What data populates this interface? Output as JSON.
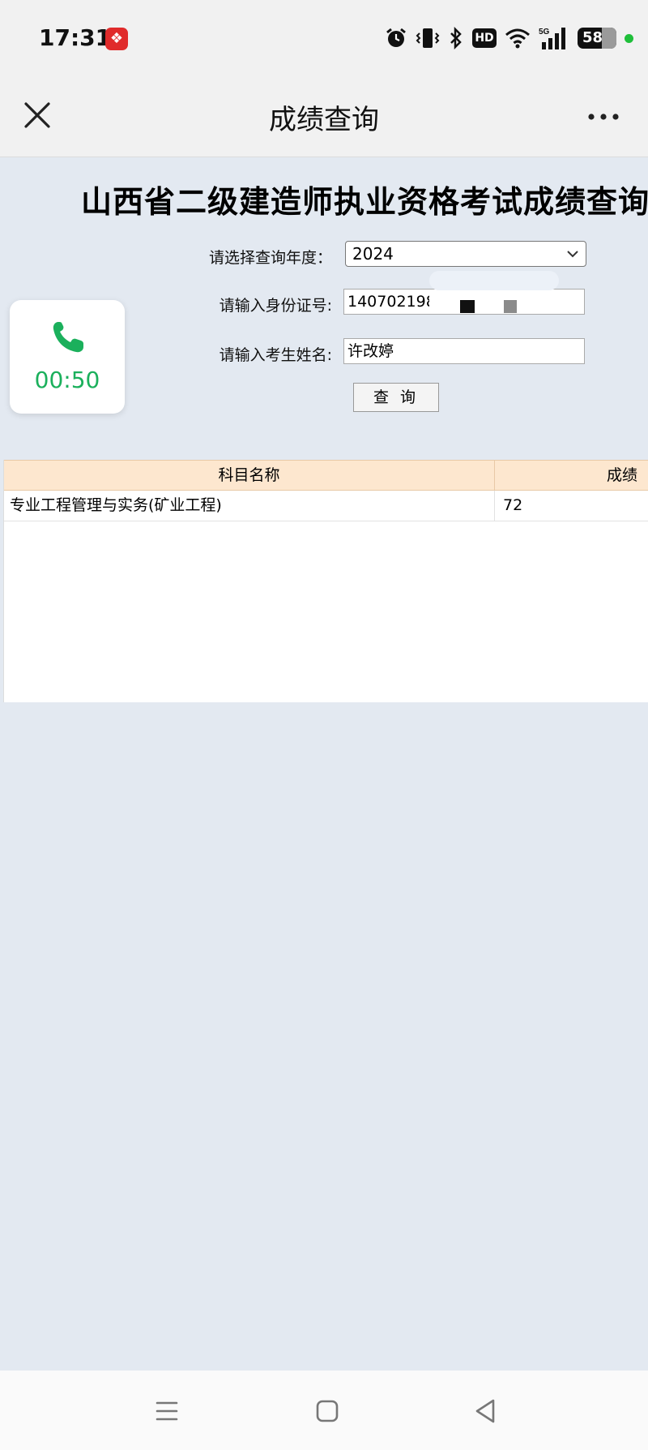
{
  "status_bar": {
    "time": "17:31",
    "app_badge_icon": "app-notification-icon",
    "icons": [
      "alarm-icon",
      "vibrate-icon",
      "bluetooth-icon",
      "hd-icon",
      "wifi-icon",
      "5g-signal-icon",
      "battery-icon"
    ],
    "hd_label": "HD",
    "network_label": "5G",
    "battery_level": "58",
    "dot_color": "#1fbf3a"
  },
  "title_bar": {
    "title": "成绩查询",
    "close_icon": "close-icon",
    "more_icon": "more-icon"
  },
  "page": {
    "heading": "山西省二级建造师执业资格考试成绩查询"
  },
  "form": {
    "year_label": "请选择查询年度：",
    "year_value": "2024",
    "id_label": "请输入身份证号:",
    "id_value": "1407021989",
    "name_label": "请输入考生姓名:",
    "name_value": "许改婷",
    "query_button": "查 询"
  },
  "call_widget": {
    "icon": "phone-icon",
    "duration": "00:50",
    "color": "#1bb05c"
  },
  "results": {
    "columns": [
      "科目名称",
      "成绩"
    ],
    "rows": [
      [
        "专业工程管理与实务(矿业工程)",
        "72"
      ]
    ],
    "header_color": "#fde7cf"
  },
  "nav_bar": {
    "icons": [
      "menu-icon",
      "home-square-icon",
      "back-triangle-icon"
    ]
  }
}
